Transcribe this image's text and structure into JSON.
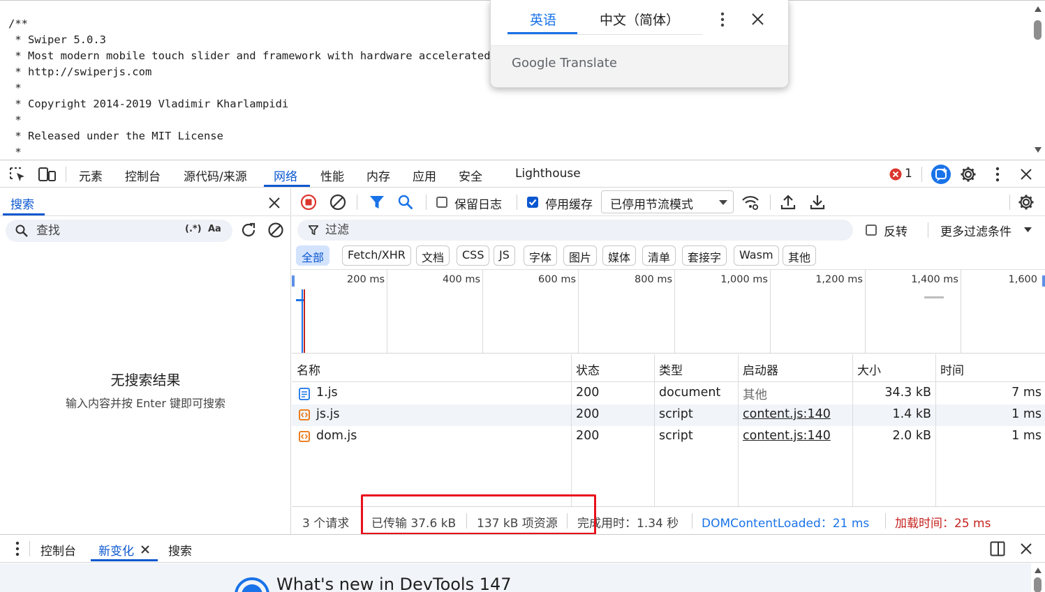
{
  "source": {
    "lines": [
      "/**",
      " * Swiper 5.0.3",
      " * Most modern mobile touch slider and framework with hardware accelerated transitions",
      " * http://swiperjs.com",
      " *",
      " * Copyright 2014-2019 Vladimir Kharlampidi",
      " *",
      " * Released under the MIT License",
      " *"
    ]
  },
  "translate": {
    "tab_english": "英语",
    "tab_chinese": "中文（简体）",
    "footer": "Google Translate"
  },
  "toolbar": {
    "tabs": [
      "元素",
      "控制台",
      "源代码/来源",
      "网络",
      "性能",
      "内存",
      "应用",
      "安全",
      "Lighthouse"
    ],
    "active_tab": "网络",
    "error_count": "1"
  },
  "search": {
    "title": "搜索",
    "placeholder": "查找",
    "regex_label": "(.*)",
    "case_label": "Aa",
    "no_results": "无搜索结果",
    "hint": "输入内容并按 Enter 键即可搜索"
  },
  "network": {
    "preserve_log": "保留日志",
    "preserve_log_checked": false,
    "disable_cache": "停用缓存",
    "disable_cache_checked": true,
    "throttling": "已停用节流模式",
    "filter_placeholder": "过滤",
    "invert": "反转",
    "more_filters": "更多过滤条件",
    "type_filters": [
      "全部",
      "Fetch/XHR",
      "文档",
      "CSS",
      "JS",
      "字体",
      "图片",
      "媒体",
      "清单",
      "套接字",
      "Wasm",
      "其他"
    ],
    "active_type_filter": "全部",
    "timeline_ticks": [
      "200 ms",
      "400 ms",
      "600 ms",
      "800 ms",
      "1,000 ms",
      "1,200 ms",
      "1,400 ms",
      "1,600"
    ],
    "columns": [
      "名称",
      "状态",
      "类型",
      "启动器",
      "大小",
      "时间"
    ],
    "rows": [
      {
        "name": "1.js",
        "status": "200",
        "type": "document",
        "initiator": "其他",
        "size": "34.3 kB",
        "time": "7 ms",
        "icon": "document-icon"
      },
      {
        "name": "js.js",
        "status": "200",
        "type": "script",
        "initiator": "content.js:140",
        "size": "1.4 kB",
        "time": "1 ms",
        "icon": "script-icon"
      },
      {
        "name": "dom.js",
        "status": "200",
        "type": "script",
        "initiator": "content.js:140",
        "size": "2.0 kB",
        "time": "1 ms",
        "icon": "script-icon"
      }
    ],
    "status_bar": {
      "requests": "3 个请求",
      "transferred": "已传输 37.6 kB",
      "resources": "137 kB 项资源",
      "finish": "完成用时：1.34 秒",
      "dcl": "DOMContentLoaded：21 ms",
      "load": "加载时间：25 ms"
    }
  },
  "drawer": {
    "tabs": [
      "控制台",
      "新变化",
      "搜索"
    ],
    "active_tab": "新变化",
    "whats_new": "What's new in DevTools 147"
  },
  "colors": {
    "accent": "#0b57d0",
    "highlight": "#e8101b",
    "dcl": "#1a73e8",
    "load": "#c5221f"
  }
}
